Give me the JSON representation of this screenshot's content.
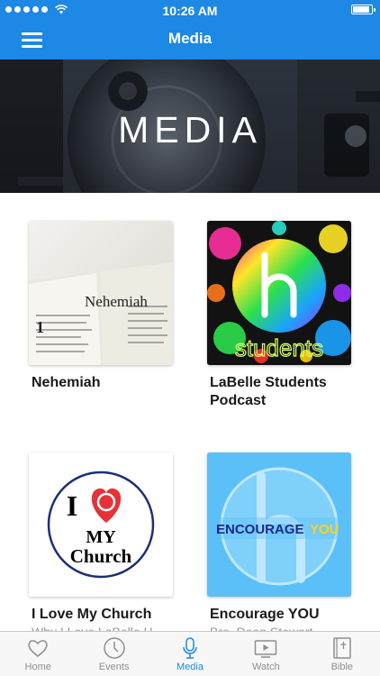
{
  "status_bar": {
    "time": "10:26 AM"
  },
  "nav": {
    "title": "Media"
  },
  "hero": {
    "title": "MEDIA"
  },
  "cards": [
    {
      "title": "Nehemiah",
      "subtitle": "",
      "thumb_text": "Nehemiah"
    },
    {
      "title": "LaBelle Students Podcast",
      "subtitle": "",
      "thumb_text": "students"
    },
    {
      "title": "I Love My Church",
      "subtitle": "Why I Love LaBelle H",
      "thumb_text_top": "I",
      "thumb_text_mid": "MY",
      "thumb_text_bottom": "Church"
    },
    {
      "title": "Encourage YOU",
      "subtitle": "Bro. Dean Stewart",
      "thumb_text_a": "ENCOURAGE",
      "thumb_text_b": "YOU"
    }
  ],
  "tabs": [
    {
      "label": "Home",
      "icon": "heart-icon"
    },
    {
      "label": "Events",
      "icon": "clock-icon"
    },
    {
      "label": "Media",
      "icon": "microphone-icon",
      "active": true
    },
    {
      "label": "Watch",
      "icon": "play-icon"
    },
    {
      "label": "Bible",
      "icon": "book-icon"
    }
  ],
  "colors": {
    "brand": "#1e88e5",
    "tab_inactive": "#8e8e8e"
  }
}
